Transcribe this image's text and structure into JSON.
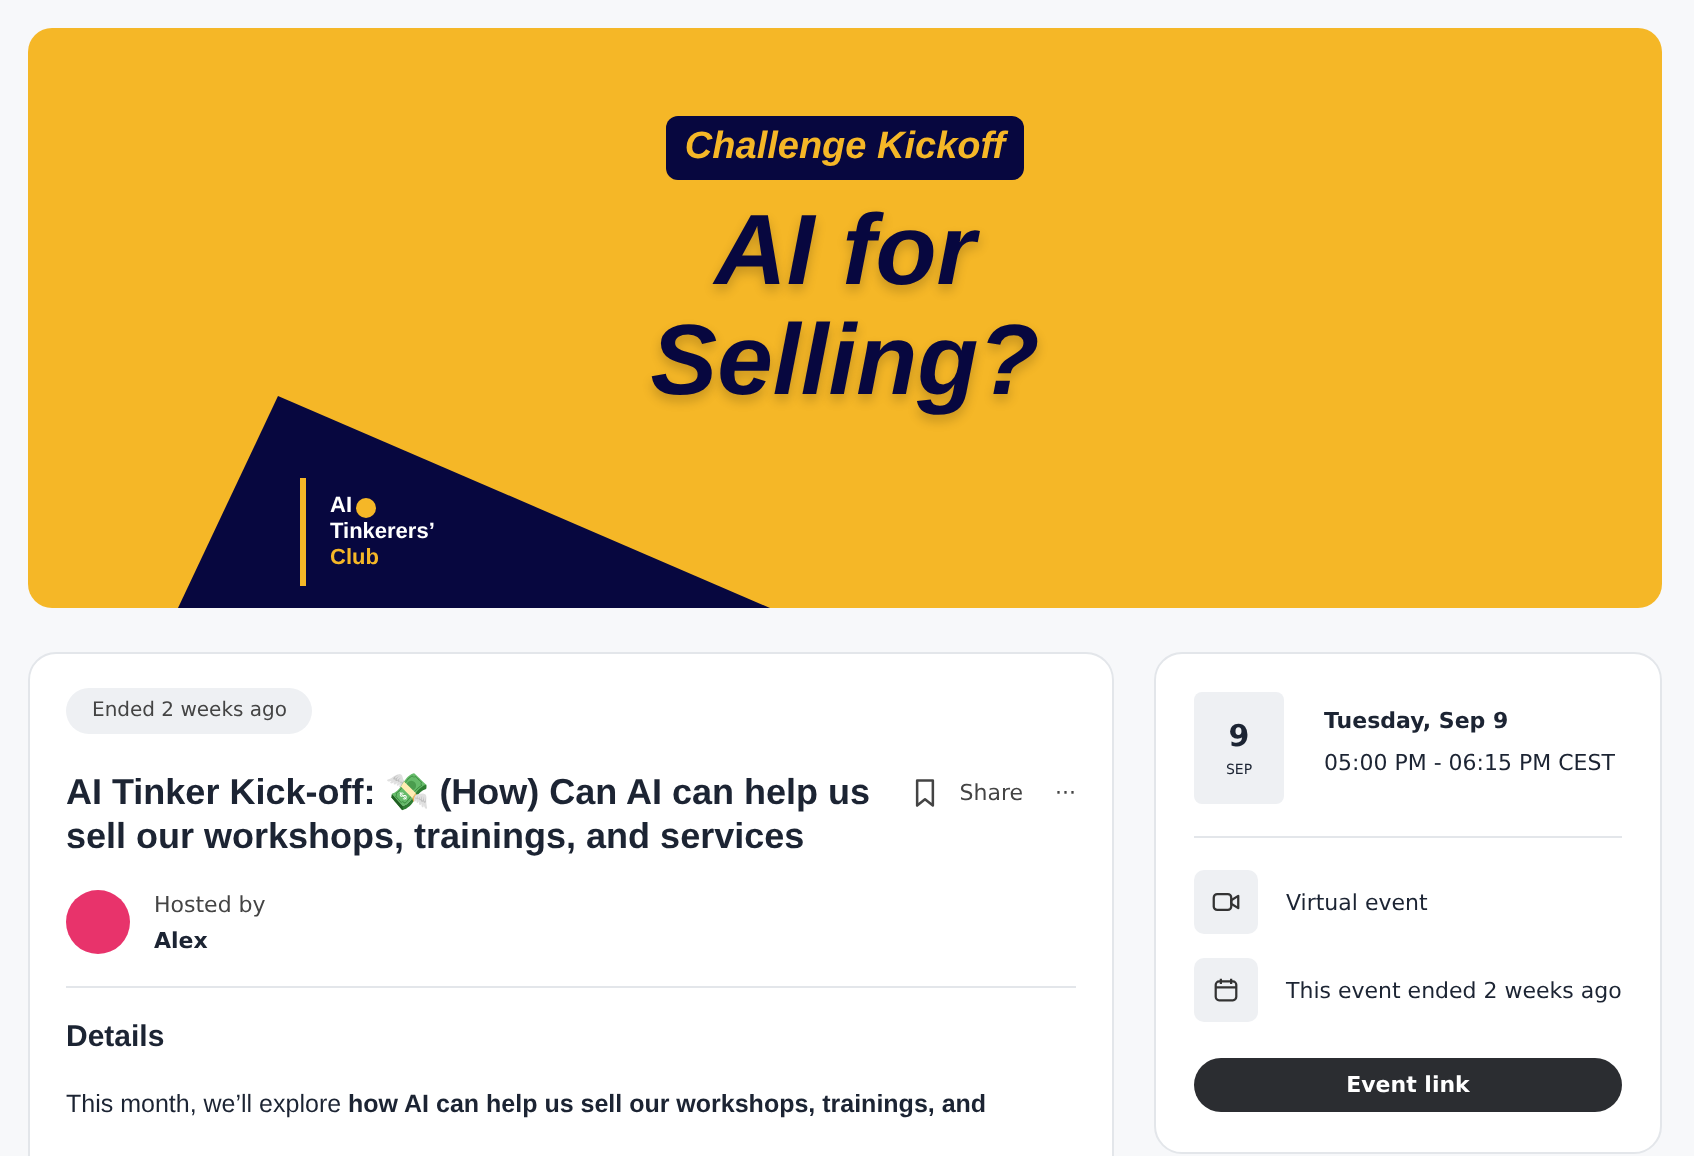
{
  "banner": {
    "tag": "Challenge Kickoff",
    "headline": "AI for Selling?",
    "logo": {
      "line_1": "AI",
      "line_2": "Tinkerers’",
      "line_3": "Club"
    }
  },
  "event": {
    "status": "Ended 2 weeks ago",
    "title": "AI Tinker Kick-off: 💸 (How) Can AI can help us sell our workshops, trainings, and services",
    "actions": {
      "share": "Share",
      "more": "···"
    },
    "host": {
      "label": "Hosted by",
      "name": "Alex"
    },
    "details_heading": "Details",
    "details_text": "This month, we’ll explore **how AI can help us sell our workshops, trainings, and**"
  },
  "schedule": {
    "day": "9",
    "month": "SEP",
    "date": "Tuesday, Sep 9",
    "time": "05:00 PM - 06:15 PM CEST",
    "info": [
      {
        "kind": "video",
        "text": "Virtual event"
      },
      {
        "kind": "calendar",
        "text": "This event ended 2 weeks ago"
      }
    ],
    "button": "Event link"
  }
}
